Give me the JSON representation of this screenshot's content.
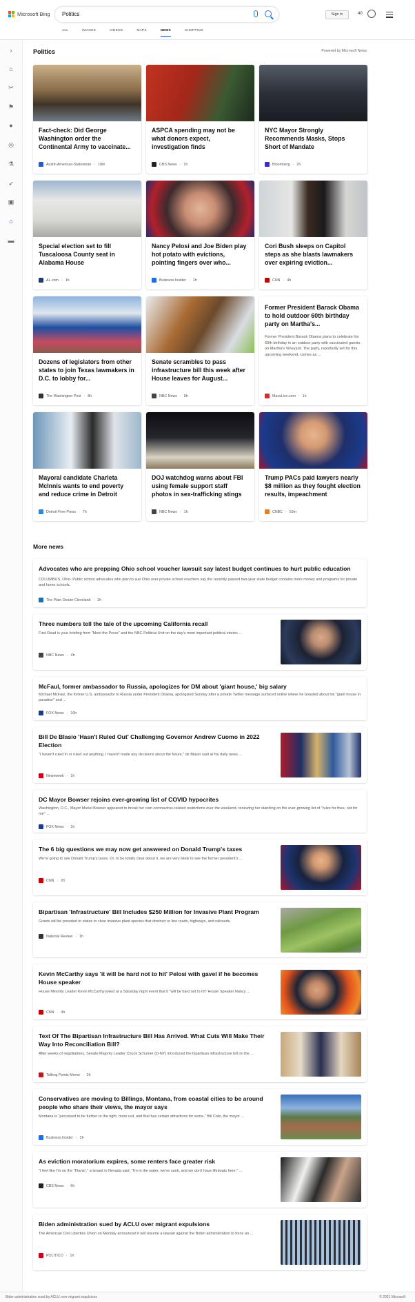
{
  "header": {
    "logo_text": "Microsoft Bing",
    "search_value": "Politics",
    "signin_label": "Sign in",
    "points": "40",
    "tabs": [
      "ALL",
      "IMAGES",
      "VIDEOS",
      "MAPS",
      "NEWS",
      "SHOPPING"
    ],
    "active_tab": "NEWS",
    "icons": [
      "microsoft-logo",
      "mic-icon",
      "search-icon",
      "rewards-icon",
      "menu-icon"
    ]
  },
  "sidebar": {
    "icons": [
      "expand-icon",
      "home-icon",
      "tools-icon",
      "flag-icon",
      "location-icon",
      "globe-icon",
      "science-icon",
      "rocket-icon",
      "film-icon",
      "bank-icon",
      "money-icon"
    ]
  },
  "section": {
    "title": "Politics",
    "powered_by": "Powered by Microsoft News"
  },
  "cards": [
    {
      "title": "Fact-check: Did George Washington order the Continental Army to vaccinate...",
      "source": "Austin American-Statesman",
      "age": "18m",
      "logo_color": "#2a5bd7"
    },
    {
      "title": "ASPCA spending may not be what donors expect, investigation finds",
      "source": "CBS News",
      "age": "1h",
      "logo_color": "#222222"
    },
    {
      "title": "NYC Mayor Strongly Recommends Masks, Stops Short of Mandate",
      "source": "Bloomberg",
      "age": "2h",
      "logo_color": "#3a2bd8"
    },
    {
      "title": "Special election set to fill Tuscaloosa County seat in Alabama House",
      "source": "AL.com",
      "age": "1h",
      "logo_color": "#1d3c78"
    },
    {
      "title": "Nancy Pelosi and Joe Biden play hot potato with evictions, pointing fingers over who...",
      "source": "Business Insider",
      "age": "1h",
      "logo_color": "#1a6ff0"
    },
    {
      "title": "Cori Bush sleeps on Capitol steps as she blasts lawmakers over expiring eviction...",
      "source": "CNN",
      "age": "4h",
      "logo_color": "#cc0000"
    },
    {
      "title": "Former President Barack Obama to hold outdoor 60th birthday party on Martha's...",
      "abstract": "Former President Barack Obama plans to celebrate his 60th birthday in an outdoor party with vaccinated guests on Martha's Vineyard. The party, reportedly set for this upcoming weekend, comes as ...",
      "source": "MassLive.com",
      "age": "1h",
      "logo_color": "#d32f2f"
    },
    {
      "title": "Dozens of legislators from other states to join Texas lawmakers in D.C. to lobby for...",
      "source": "The Washington Post",
      "age": "8h",
      "logo_color": "#333333"
    },
    {
      "title": "Senate scrambles to pass infrastructure bill this week after House leaves for August...",
      "source": "NBC News",
      "age": "9h",
      "logo_color": "#444444"
    },
    {
      "title": "Mayoral candidate Charleta McInnis wants to end poverty and reduce crime in Detroit",
      "source": "Detroit Free Press",
      "age": "7h",
      "logo_color": "#2e86de"
    },
    {
      "title": "DOJ watchdog warns about FBI using female support staff photos in sex-trafficking stings",
      "source": "NBC News",
      "age": "1h",
      "logo_color": "#444444"
    },
    {
      "title": "Trump PACs paid lawyers nearly $8 million as they fought election results, impeachment",
      "source": "CNBC",
      "age": "59m",
      "logo_color": "#e67e22"
    }
  ],
  "more_news": {
    "title": "More news",
    "items": [
      {
        "title": "Advocates who are prepping Ohio school voucher lawsuit say latest budget continues to hurt public education",
        "abstract": "COLUMBUS, Ohio- Public school advocates who plan to sue Ohio over private school vouchers say the recently passed two-year state budget contains more money and programs for private and home schools.",
        "source": "The Plain Dealer Cleveland",
        "age": "2h",
        "logo_color": "#1f6fb2"
      },
      {
        "title": "Three numbers tell the tale of the upcoming California recall",
        "abstract": "First Read is your briefing from \"Meet the Press\" and the NBC Political Unit on the day's most important political stories ...",
        "source": "NBC News",
        "age": "4h",
        "logo_color": "#444444"
      },
      {
        "title": "McFaul, former ambassador to Russia, apologizes for DM about 'giant house,' big salary",
        "abstract": "Michael McFaul, the former U.S. ambassador to Russia under President Obama, apologized Sunday after a private Twitter message surfaced online where he boasted about his \"giant house in paradise\" and ...",
        "source": "FOX News",
        "age": "10h",
        "logo_color": "#1d3b8a"
      },
      {
        "title": "Bill De Blasio 'Hasn't Ruled Out' Challenging Governor Andrew Cuomo in 2022 Election",
        "abstract": "\"I haven't ruled in or ruled out anything. I haven't made any decisions about the future,\" de Blasio said at his daily news ...",
        "source": "Newsweek",
        "age": "1h",
        "logo_color": "#d0021b"
      },
      {
        "title": "DC Mayor Bowser rejoins ever-growing list of COVID hypocrites",
        "abstract": "Washington, D.C., Mayor Muriel Bowser appeared to break her own coronavirus-related restrictions over the weekend, renewing her standing on the ever-growing list of \"rules for thee, not for me\" ...",
        "source": "FOX News",
        "age": "1h",
        "logo_color": "#1d3b8a"
      },
      {
        "title": "The 6 big questions we may now get answered on Donald Trump's taxes",
        "abstract": "We're going to see Donald Trump's taxes. Or, to be totally clear about it, we are very likely to see the former president's ...",
        "source": "CNN",
        "age": "2h",
        "logo_color": "#cc0000"
      },
      {
        "title": "Bipartisan 'Infrastructure' Bill Includes $250 Million for Invasive Plant Program",
        "abstract": "Grants will be provided to states to clear invasive plant species that obstruct or line roads, highways, and railroads.",
        "source": "National Review",
        "age": "1h",
        "logo_color": "#333333"
      },
      {
        "title": "Kevin McCarthy says 'it will be hard not to hit' Pelosi with gavel if he becomes House speaker",
        "abstract": "House Minority Leader Kevin McCarthy joked at a Saturday night event that it \"will be hard not to hit\" House Speaker Nancy ...",
        "source": "CNN",
        "age": "4h",
        "logo_color": "#cc0000"
      },
      {
        "title": "Text Of The Bipartisan Infrastructure Bill Has Arrived. What Cuts Will Make Their Way Into Reconciliation Bill?",
        "abstract": "After weeks of negotiations, Senate Majority Leader Chuck Schumer (D-NY) introduced the bipartisan infrastructure bill on the ...",
        "source": "Talking Points Memo",
        "age": "2h",
        "logo_color": "#b71c1c"
      },
      {
        "title": "Conservatives are moving to Billings, Montana, from coastal cities to be around people who share their views, the mayor says",
        "abstract": "Montana is \"perceived to be further to the right, more red, and that has certain attractions for some,\" Bill Cole, the mayor ...",
        "source": "Business Insider",
        "age": "2h",
        "logo_color": "#1a6ff0"
      },
      {
        "title": "As eviction moratorium expires, some renters face greater risk",
        "abstract": "\"I feel like I'm on the 'Titanic',\" a tenant in Nevada said. \"I'm in the water, we've sunk, and we don't have lifeboats here.\" ...",
        "source": "CBS News",
        "age": "6h",
        "logo_color": "#222222"
      },
      {
        "title": "Biden administration sued by ACLU over migrant expulsions",
        "abstract": "The American Civil Liberties Union on Monday announced it will resume a lawsuit against the Biden administration to force an ...",
        "source": "POLITICO",
        "age": "1h",
        "logo_color": "#d0021b"
      }
    ]
  },
  "footer": {
    "left": "Biden administration sued by ACLU over migrant expulsions",
    "right": "© 2021 Microsoft"
  }
}
